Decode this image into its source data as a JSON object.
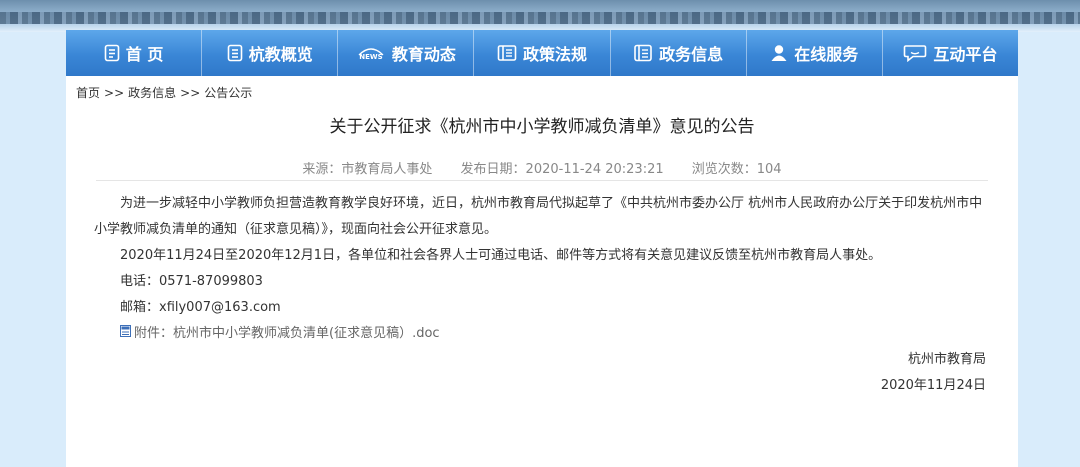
{
  "nav": {
    "items": [
      {
        "label": "首 页",
        "icon": "home-doc-icon"
      },
      {
        "label": "杭教概览",
        "icon": "overview-doc-icon"
      },
      {
        "label": "教育动态",
        "icon": "news-icon"
      },
      {
        "label": "政策法规",
        "icon": "book-icon"
      },
      {
        "label": "政务信息",
        "icon": "notebook-icon"
      },
      {
        "label": "在线服务",
        "icon": "person-icon"
      },
      {
        "label": "互动平台",
        "icon": "chat-icon"
      }
    ]
  },
  "breadcrumb": {
    "home": "首页",
    "section": "政务信息",
    "current": "公告公示",
    "sep": ">>"
  },
  "article": {
    "title": "关于公开征求《杭州市中小学教师减负清单》意见的公告",
    "source": "来源：市教育局人事处",
    "date": "发布日期：2020-11-24 20:23:21",
    "views": "浏览次数：104",
    "para1": "为进一步减轻中小学教师负担营造教育教学良好环境，近日，杭州市教育局代拟起草了《中共杭州市委办公厅 杭州市人民政府办公厅关于印发杭州市中小学教师减负清单的通知（征求意见稿）》，现面向社会公开征求意见。",
    "para2": "2020年11月24日至2020年12月1日，各单位和社会各界人士可通过电话、邮件等方式将有关意见建议反馈至杭州市教育局人事处。",
    "phone": "电话：0571-87099803",
    "email": "邮箱：xfily007@163.com",
    "attachment": "附件：杭州市中小学教师减负清单(征求意见稿）.doc",
    "signature": "杭州市教育局",
    "sign_date": "2020年11月24日"
  },
  "colors": {
    "nav_top": "#5da7ea",
    "nav_bottom": "#2f78c9",
    "page_background": "#d9ecfb"
  }
}
